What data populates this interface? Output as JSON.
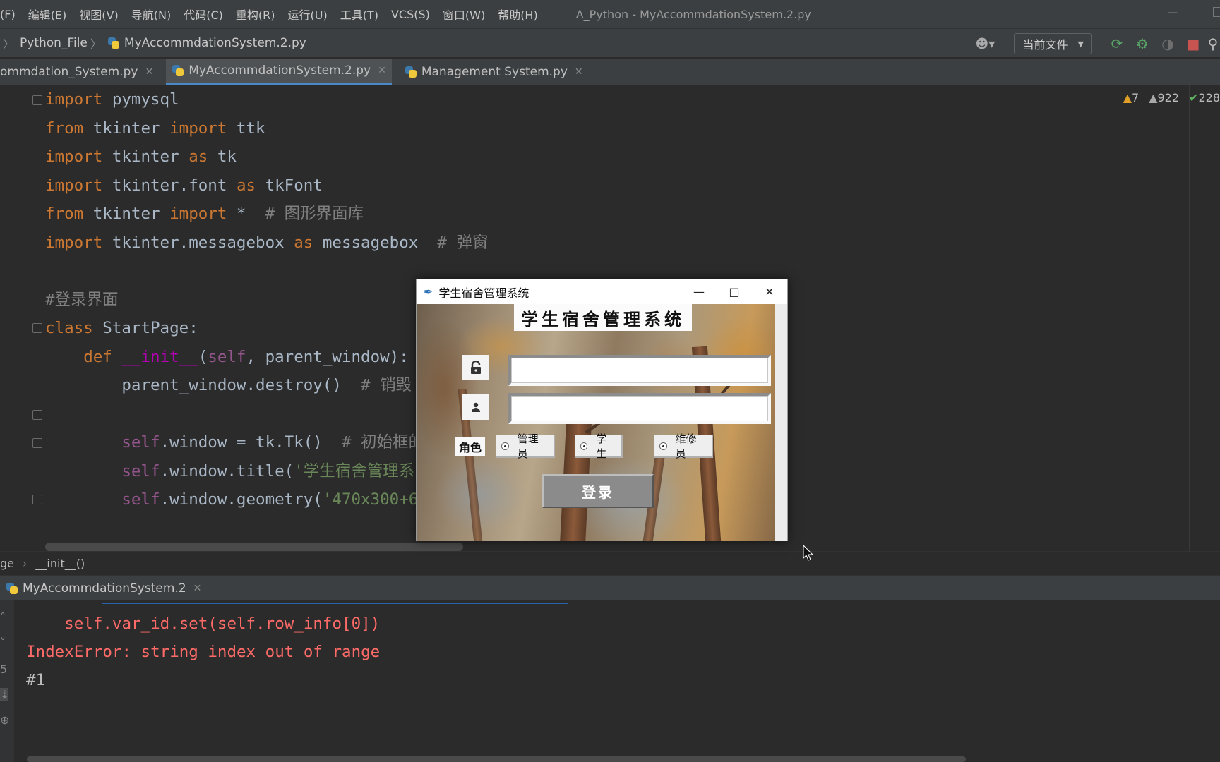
{
  "menu": {
    "items": [
      "(F)",
      "编辑(E)",
      "视图(V)",
      "导航(N)",
      "代码(C)",
      "重构(R)",
      "运行(U)",
      "工具(T)",
      "VCS(S)",
      "窗口(W)",
      "帮助(H)"
    ],
    "window_title": "A_Python - MyAccommdationSystem.2.py"
  },
  "nav": {
    "crumbs": [
      "Python_File",
      "MyAccommdationSystem.2.py"
    ],
    "run_config": "当前文件"
  },
  "tabs": [
    {
      "label": "ommdation_System.py",
      "active": false
    },
    {
      "label": "MyAccommdationSystem.2.py",
      "active": true
    },
    {
      "label": "Management System.py",
      "active": false
    }
  ],
  "inspections": {
    "warnings": "7",
    "weak_warnings": "922",
    "ok": "228"
  },
  "code": {
    "l1_kw": "import",
    "l1_rest": " pymysql",
    "l2_kw1": "from",
    "l2_mod": " tkinter ",
    "l2_kw2": "import",
    "l2_rest": " ttk",
    "l3_kw1": "import",
    "l3_mod": " tkinter ",
    "l3_kw2": "as",
    "l3_rest": " tk",
    "l4_kw1": "import",
    "l4_mod": " tkinter.font ",
    "l4_kw2": "as",
    "l4_rest": " tkFont",
    "l5_kw1": "from",
    "l5_mod": " tkinter ",
    "l5_kw2": "import",
    "l5_rest": " *  ",
    "l5_cm": "# 图形界面库",
    "l6_kw1": "import",
    "l6_mod": " tkinter.messagebox ",
    "l6_kw2": "as",
    "l6_rest": " messagebox  ",
    "l6_cm": "# 弹窗",
    "l8_cm": "#登录界面",
    "l9_kw": "class",
    "l9_rest": " StartPage:",
    "l10_indent": "    ",
    "l10_kw": "def",
    "l10_sp": " ",
    "l10_fn": "__init__",
    "l10_p1": "(",
    "l10_self": "self",
    "l10_rest": ", parent_window):",
    "l11_indent": "        ",
    "l11_rest": "parent_window.destroy()  ",
    "l11_cm": "# 销毁",
    "l13_indent": "        ",
    "l13_self": "self",
    "l13_rest": ".window = tk.Tk()  ",
    "l13_cm": "# 初始框的",
    "l14_indent": "        ",
    "l14_self": "self",
    "l14_rest": ".window.title(",
    "l14_st": "'学生宿舍管理系",
    "l15_indent": "        ",
    "l15_self": "self",
    "l15_rest": ".window.geometry(",
    "l15_st": "'470x300+6"
  },
  "breadcrumb": {
    "class": "ge",
    "method": "__init__()"
  },
  "run": {
    "tab_label": "MyAccommdationSystem.2",
    "line1": "    self.var_id.set(self.row_info[0])",
    "line2": "IndexError: string index out of range",
    "line3": "#1"
  },
  "dialog": {
    "window_title": "学生宿舍管理系统",
    "app_title": "学生宿舍管理系统",
    "username_value": "",
    "password_value": "",
    "role_label": "角色",
    "roles": [
      "管理员",
      "学生",
      "维修员"
    ],
    "login_label": "登录"
  }
}
